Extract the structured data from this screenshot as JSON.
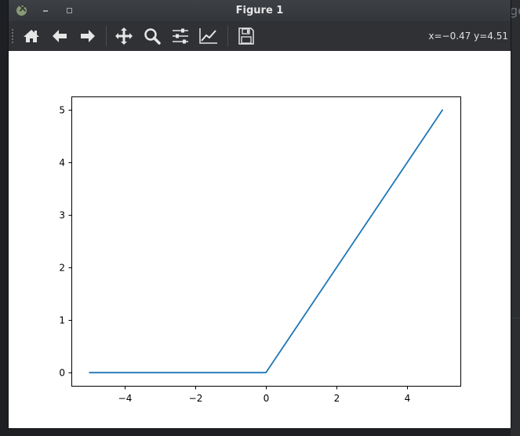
{
  "window": {
    "title": "Figure 1"
  },
  "background": {
    "partial_text": "ge"
  },
  "toolbar": {
    "buttons": [
      {
        "name": "home-icon"
      },
      {
        "name": "back-icon"
      },
      {
        "name": "forward-icon"
      },
      {
        "name": "pan-icon"
      },
      {
        "name": "zoom-icon"
      },
      {
        "name": "subplots-icon"
      },
      {
        "name": "edit-axis-icon"
      },
      {
        "name": "save-icon"
      }
    ],
    "coords": "x=−0.47 y=4.51"
  },
  "chart_data": {
    "type": "line",
    "x": [
      -5,
      0,
      5
    ],
    "series": [
      {
        "values": [
          0,
          0,
          5
        ],
        "color": "#1f77b4"
      }
    ],
    "xlim": [
      -5.5,
      5.5
    ],
    "ylim": [
      -0.25,
      5.25
    ],
    "xticks": [
      -4,
      -2,
      0,
      2,
      4
    ],
    "yticks": [
      0,
      1,
      2,
      3,
      4,
      5
    ],
    "xtick_labels": [
      "−4",
      "−2",
      "0",
      "2",
      "4"
    ],
    "ytick_labels": [
      "0",
      "1",
      "2",
      "3",
      "4",
      "5"
    ],
    "grid": false
  }
}
